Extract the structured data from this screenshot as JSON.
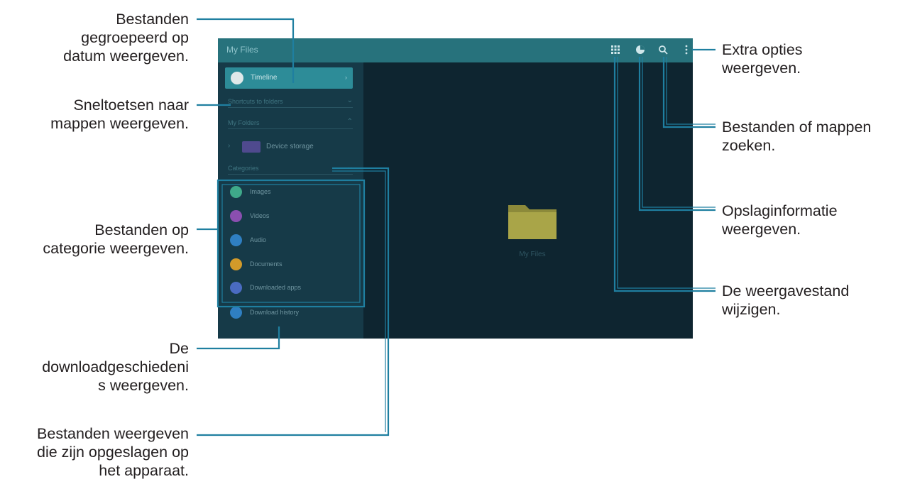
{
  "app": {
    "title": "My Files",
    "selected_item": "Timeline",
    "sections": [
      {
        "label": "Shortcuts to folders"
      },
      {
        "label": "My Folders"
      },
      {
        "label": "Categories"
      }
    ],
    "device_storage": "Device storage",
    "categories": [
      {
        "label": "Images",
        "color": "#3fa98a"
      },
      {
        "label": "Videos",
        "color": "#8a4fb0"
      },
      {
        "label": "Audio",
        "color": "#2f7fc2"
      },
      {
        "label": "Documents",
        "color": "#d29a2a"
      },
      {
        "label": "Downloaded apps",
        "color": "#4a6bc2"
      }
    ],
    "download_history": {
      "label": "Download history",
      "color": "#2f7fc2"
    },
    "empty_label": "My Files",
    "icons": [
      "grid-view-icon",
      "storage-pie-icon",
      "search-icon",
      "more-options-icon",
      "folder-icon"
    ]
  },
  "callouts": {
    "group_by_date": [
      "Bestanden",
      "gegroepeerd op",
      "datum weergeven."
    ],
    "shortcuts": [
      "Sneltoetsen naar",
      "mappen weergeven."
    ],
    "by_category": [
      "Bestanden op",
      "categorie weergeven."
    ],
    "download_history": [
      "De",
      "downloadgeschiedeni",
      "s weergeven."
    ],
    "device_files": [
      "Bestanden weergeven",
      "die zijn opgeslagen op",
      "het apparaat."
    ],
    "extra_options": [
      "Extra opties",
      "weergeven."
    ],
    "search": [
      "Bestanden of mappen",
      "zoeken."
    ],
    "storage_info": [
      "Opslaginformatie",
      "weergeven."
    ],
    "view_mode": [
      "De weergavestand",
      "wijzigen."
    ]
  },
  "colors": {
    "appbar": "#27727c",
    "sidebar": "#163a48",
    "main": "#0e2530",
    "callout_line": "#1f7fa0"
  }
}
